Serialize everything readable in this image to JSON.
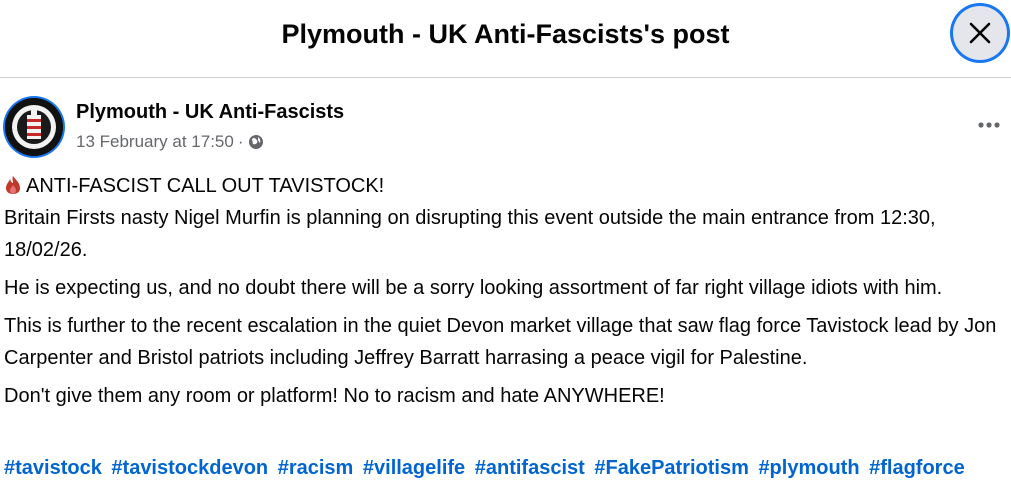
{
  "dialog": {
    "title": "Plymouth - UK Anti-Fascists's post",
    "close_icon": "close-icon"
  },
  "post": {
    "author": "Plymouth - UK Anti-Fascists",
    "timestamp": "13 February at 17:50",
    "separator": "·",
    "audience_icon": "globe-icon",
    "more_icon": "more-options-icon",
    "headline": "ANTI-FASCIST  CALL OUT  TAVISTOCK!",
    "headline_icon": "fire-icon",
    "paragraphs": [
      "Britain Firsts nasty Nigel Murfin  is planning on disrupting this event outside the main entrance from 12:30, 18/02/26.",
      "He is expecting us, and no doubt there will be a sorry looking assortment of far right village idiots with him.",
      "This is further to the recent escalation in the quiet Devon market village that saw flag force Tavistock lead by Jon Carpenter and Bristol patriots including Jeffrey Barratt harrasing a peace vigil for Palestine.",
      "Don't give them any room or platform! No to racism and hate ANYWHERE!"
    ],
    "hashtags": [
      "#tavistock",
      "#tavistockdevon",
      "#racism",
      "#villagelife",
      "#antifascist",
      "#FakePatriotism",
      "#plymouth",
      "#flagforce"
    ]
  },
  "colors": {
    "accent": "#1877f2",
    "hashtag": "#0064d1",
    "secondary_text": "#65676b"
  }
}
